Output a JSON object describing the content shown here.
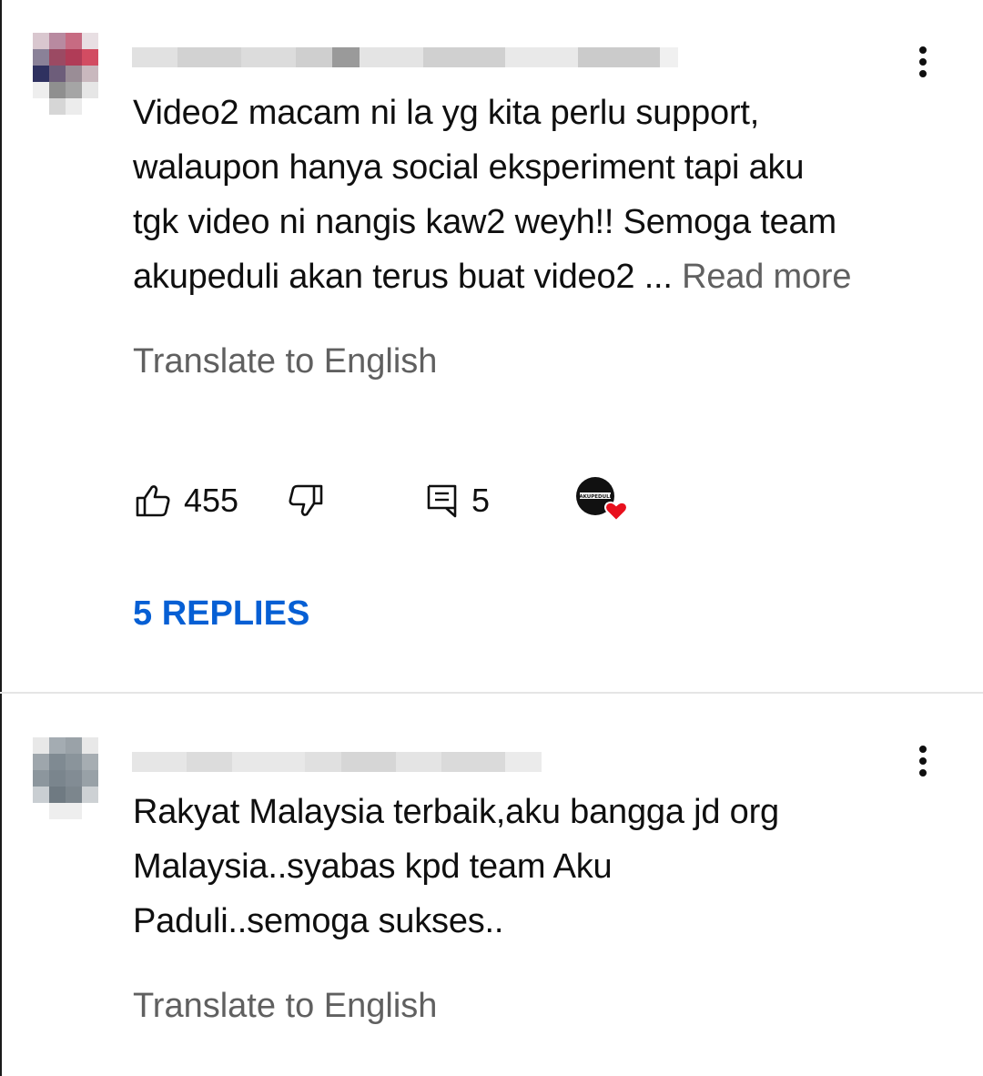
{
  "comments": [
    {
      "text_lines": [
        "Video2 macam ni la yg kita perlu support,",
        "walaupon hanya social eksperiment tapi aku",
        "tgk video ni  nangis kaw2 weyh!! Semoga team",
        "akupeduli akan terus buat video2 ... "
      ],
      "read_more": "Read more",
      "translate": "Translate to English",
      "likes": "455",
      "reply_count": "5",
      "creator_heart_logo_text": "AKUPEDULI",
      "replies_label": "5 REPLIES"
    },
    {
      "text_lines": [
        "Rakyat Malaysia terbaik,aku bangga jd org",
        "Malaysia..syabas kpd team Aku",
        "Paduli..semoga sukses.."
      ],
      "translate": "Translate to English"
    }
  ],
  "colors": {
    "link_blue": "#065fd4",
    "secondary_text": "#606060",
    "heart_red": "#e8101d"
  },
  "icons": [
    "more-vert-icon",
    "thumbs-up-icon",
    "thumbs-down-icon",
    "reply-icon",
    "creator-heart-icon"
  ]
}
